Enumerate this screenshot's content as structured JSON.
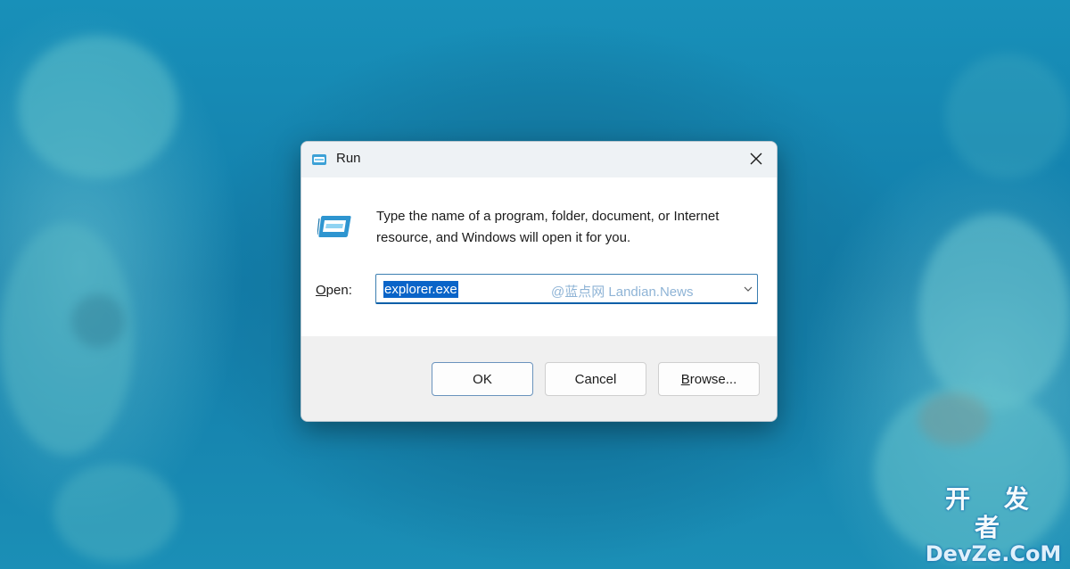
{
  "desktop": {
    "corner_watermark_cn": "开 发 者",
    "corner_watermark_en": "DevZe.CoM"
  },
  "dialog": {
    "title": "Run",
    "description": "Type the name of a program, folder, document, or Internet resource, and Windows will open it for you.",
    "open_label_accel": "O",
    "open_label_rest": "pen:",
    "open_value": "explorer.exe",
    "overlay_watermark": "@蓝点网 Landian.News",
    "buttons": {
      "ok": "OK",
      "cancel": "Cancel",
      "browse_accel": "B",
      "browse_rest": "rowse..."
    }
  },
  "icons": {
    "title_icon": "run-app-icon",
    "main_icon": "run-app-icon",
    "close": "close-icon",
    "dropdown": "chevron-down-icon"
  },
  "colors": {
    "selection": "#0a64c8",
    "titlebar": "#eef2f5",
    "footer": "#f0f0f0",
    "focus_border": "#0a5fa8"
  }
}
